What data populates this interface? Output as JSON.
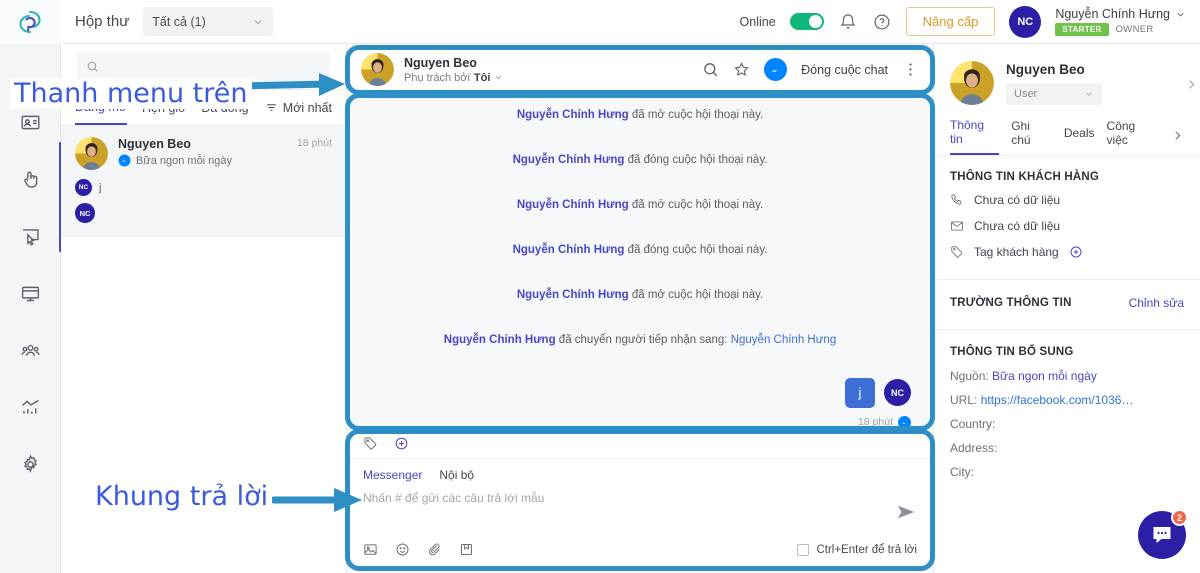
{
  "app": {
    "logo_icon": "swirl-logo-icon",
    "accent_purple": "#4a46c7",
    "accent_blue": "#0084ff",
    "annotation_border": "#2e8fc4",
    "annotation_text_color": "#3b5bdb"
  },
  "topbar": {
    "title": "Hộp thư",
    "filter_value": "Tất cả (1)",
    "online_label": "Online",
    "online_on": true,
    "bell_icon": "bell-icon",
    "help_icon": "question-circle-icon",
    "upgrade_label": "Nâng cấp",
    "user_initials": "NC",
    "user_name": "Nguyễn Chính Hưng",
    "plan_badge": "STARTER",
    "role_badge": "OWNER",
    "chevron_icon": "chevron-down-icon"
  },
  "rail": {
    "items": [
      {
        "icon": "contact-card-icon",
        "name": "contacts"
      },
      {
        "icon": "touch-pointer-icon",
        "name": "engagement"
      },
      {
        "icon": "cursor-select-icon",
        "name": "campaigns"
      },
      {
        "icon": "monitor-icon",
        "name": "website"
      },
      {
        "icon": "team-icon",
        "name": "team"
      },
      {
        "icon": "chart-line-icon",
        "name": "analytics"
      },
      {
        "icon": "gear-icon",
        "name": "settings"
      }
    ]
  },
  "conversation_list": {
    "search_placeholder": "",
    "search_icon": "search-icon",
    "tabs": [
      {
        "label": "Đang mở",
        "active": true
      },
      {
        "label": "Hẹn giờ",
        "active": false
      },
      {
        "label": "Đã đóng",
        "active": false
      }
    ],
    "sort_icon": "filter-sort-icon",
    "sort_label": "Mới nhất",
    "items": [
      {
        "name": "Nguyen Beo",
        "channel_icon": "messenger-icon",
        "subtitle": "Bữa ngon mỗi ngày",
        "time": "18 phút",
        "tags": [
          {
            "initials": "NC",
            "text": "j"
          },
          {
            "initials": "NC",
            "text": ""
          }
        ]
      }
    ]
  },
  "chat": {
    "header": {
      "name": "Nguyen Beo",
      "assign_prefix": "Phụ trách bởi",
      "assign_value": "Tôi",
      "chevron_icon": "chevron-down-icon",
      "search_icon": "search-icon",
      "star_icon": "star-icon",
      "messenger_icon": "messenger-icon",
      "close_chat_label": "Đóng cuộc chat",
      "more_icon": "more-vertical-icon"
    },
    "messages": [
      {
        "actor": "Nguyễn Chính Hưng",
        "text": " đã mở cuộc hội thoại này."
      },
      {
        "actor": "Nguyễn Chính Hưng",
        "text": " đã đóng cuộc hội thoại này."
      },
      {
        "actor": "Nguyễn Chính Hưng",
        "text": " đã mở cuộc hội thoại này."
      },
      {
        "actor": "Nguyễn Chính Hưng",
        "text": " đã đóng cuộc hội thoại này."
      },
      {
        "actor": "Nguyễn Chính Hưng",
        "text": " đã mở cuộc hội thoại này."
      }
    ],
    "transfer": {
      "actor": "Nguyễn Chính Hưng",
      "text": " đã chuyển người tiếp nhận sang: ",
      "target": "Nguyễn Chính Hưng"
    },
    "bubble": {
      "text": "j",
      "avatar_initials": "NC",
      "time": "18 phút",
      "status_icon": "messenger-icon"
    }
  },
  "reply": {
    "tag_icon": "tag-icon",
    "add_icon": "plus-circle-icon",
    "tabs": [
      {
        "label": "Messenger",
        "active": true
      },
      {
        "label": "Nội bộ",
        "active": false
      }
    ],
    "placeholder": "Nhấn # để gửi các câu trả lời mẫu",
    "send_icon": "send-icon",
    "tools": [
      {
        "icon": "image-icon",
        "name": "insert-image"
      },
      {
        "icon": "emoji-icon",
        "name": "insert-emoji"
      },
      {
        "icon": "attachment-icon",
        "name": "attach-file"
      },
      {
        "icon": "save-icon",
        "name": "save-template"
      }
    ],
    "shortcut_label": "Ctrl+Enter để trả lời",
    "shortcut_checked": false
  },
  "right_panel": {
    "profile_name": "Nguyen Beo",
    "role_value": "User",
    "role_chevron": "chevron-down-icon",
    "expand_icon": "chevron-right-icon",
    "tabs": [
      {
        "label": "Thông tin",
        "active": true
      },
      {
        "label": "Ghi chú",
        "active": false
      },
      {
        "label": "Deals",
        "active": false
      },
      {
        "label": "Công việc",
        "active": false
      }
    ],
    "tabs_more_icon": "chevron-right-icon",
    "customer_section_title": "THÔNG TIN KHÁCH HÀNG",
    "customer_rows": [
      {
        "icon": "phone-icon",
        "value": "Chưa có dữ liệu"
      },
      {
        "icon": "mail-icon",
        "value": "Chưa có dữ liệu"
      },
      {
        "icon": "tag-icon",
        "value": "Tag khách hàng",
        "add_icon": "plus-circle-icon"
      }
    ],
    "fields_section_title": "TRƯỜNG THÔNG TIN",
    "fields_edit_label": "Chỉnh sửa",
    "extra_section_title": "THÔNG TIN BỔ SUNG",
    "extra_rows": [
      {
        "key": "Nguồn:",
        "value": "Bữa ngon mỗi ngày",
        "style": "accent"
      },
      {
        "key": "URL:",
        "value": "https://facebook.com/1036…",
        "style": "link"
      },
      {
        "key": "Country:",
        "value": "",
        "style": "plain"
      },
      {
        "key": "Address:",
        "value": "",
        "style": "plain"
      },
      {
        "key": "City:",
        "value": "",
        "style": "plain"
      }
    ],
    "fab_icon": "chat-bubble-icon",
    "fab_badge": "2"
  },
  "annotations": [
    {
      "text": "Thanh menu trên",
      "target": "top-menu-bar"
    },
    {
      "text": "Khung trả lời",
      "target": "reply-box"
    }
  ]
}
